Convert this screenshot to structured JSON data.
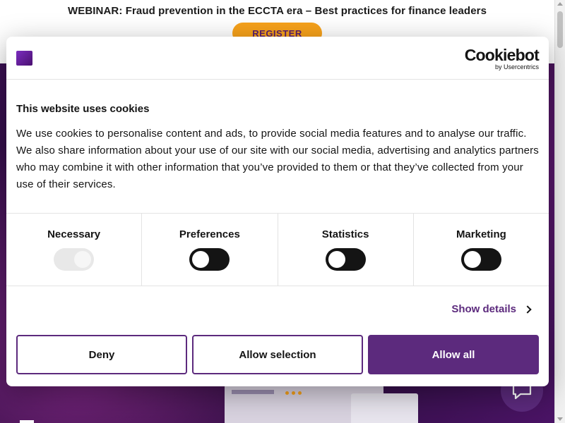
{
  "banner": {
    "text": "WEBINAR: Fraud prevention in the ECCTA era – Best practices for finance leaders",
    "register_label": "REGISTER"
  },
  "cookie_dialog": {
    "brand": "Cookiebot",
    "brand_sub": "by Usercentrics",
    "title": "This website uses cookies",
    "body": "We use cookies to personalise content and ads, to provide social media features and to analyse our traffic. We also share information about your use of our site with our social media, advertising and analytics partners who may combine it with other information that you’ve provided to them or that they’ve collected from your use of their services.",
    "categories": [
      {
        "label": "Necessary",
        "checked": true,
        "disabled": true
      },
      {
        "label": "Preferences",
        "checked": false,
        "disabled": false
      },
      {
        "label": "Statistics",
        "checked": false,
        "disabled": false
      },
      {
        "label": "Marketing",
        "checked": false,
        "disabled": false
      }
    ],
    "show_details_label": "Show details",
    "buttons": {
      "deny": "Deny",
      "allow_selection": "Allow selection",
      "allow_all": "Allow all"
    }
  },
  "colors": {
    "accent": "#5c2a7d",
    "register": "#f7a21b"
  },
  "icons": {
    "chat": "chat-bubble-icon",
    "details": "chevron-right-icon"
  }
}
